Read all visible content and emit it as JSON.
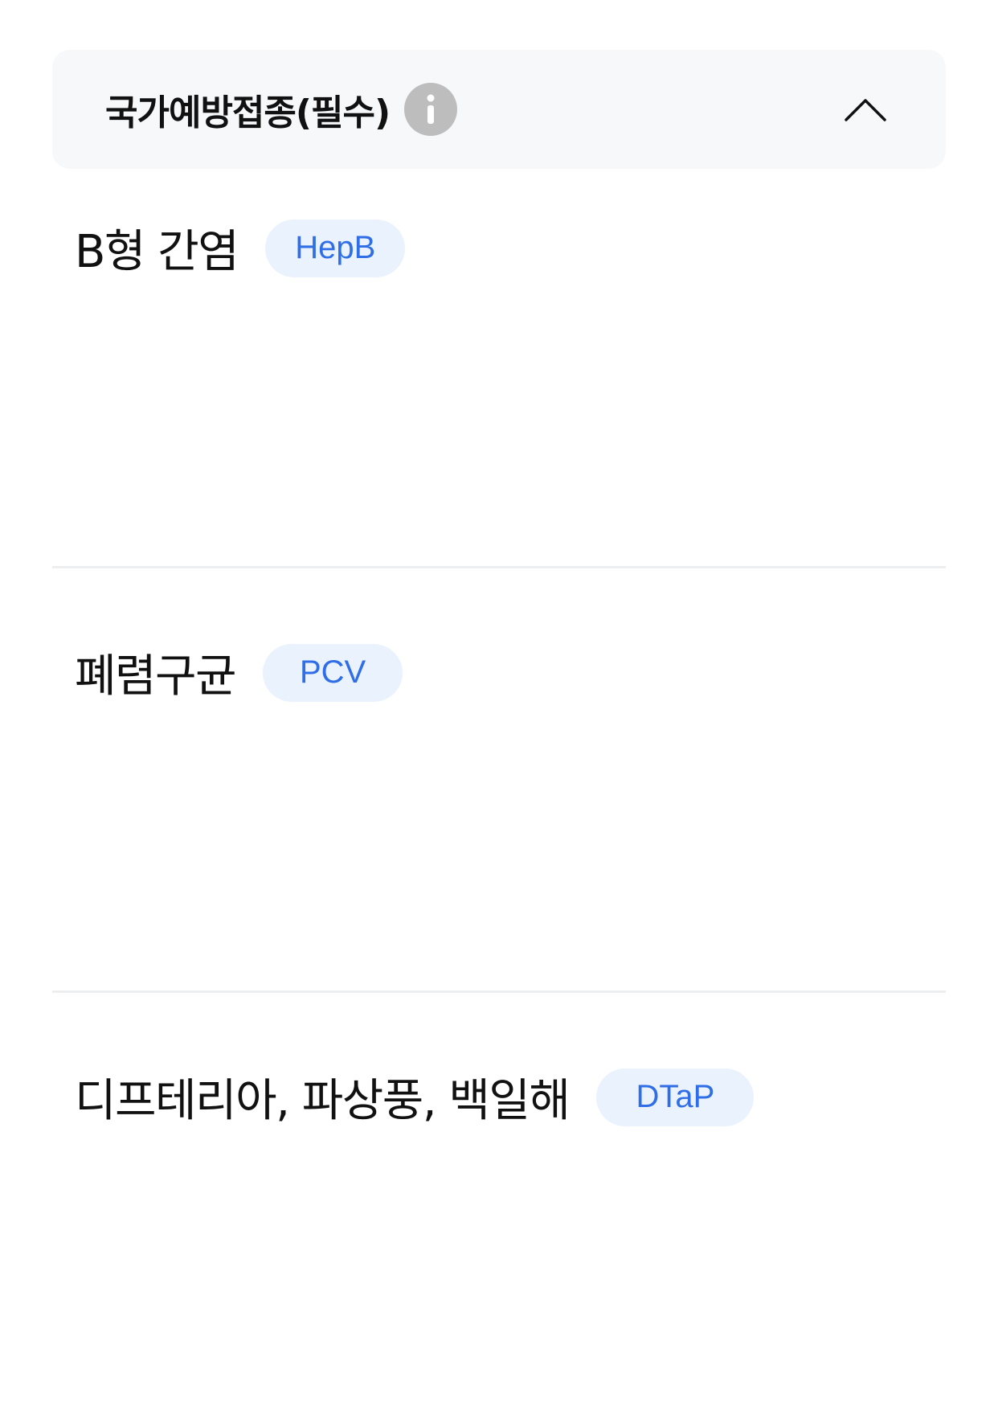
{
  "section": {
    "title": "국가예방접종(필수)",
    "info_icon": "info-icon",
    "toggle_icon": "chevron-up-icon",
    "expanded": true
  },
  "vaccines": [
    {
      "name": "B형 간염",
      "badge": "HepB"
    },
    {
      "name": "폐렴구균",
      "badge": "PCV"
    },
    {
      "name": "디프테리아, 파상풍, 백일해",
      "badge": "DTaP"
    }
  ],
  "colors": {
    "header_bg": "#f7f8fa",
    "badge_bg": "#eaf2fe",
    "badge_text": "#2f6ee6",
    "info_icon_bg": "#bdbdbd",
    "divider": "#eceef0"
  }
}
